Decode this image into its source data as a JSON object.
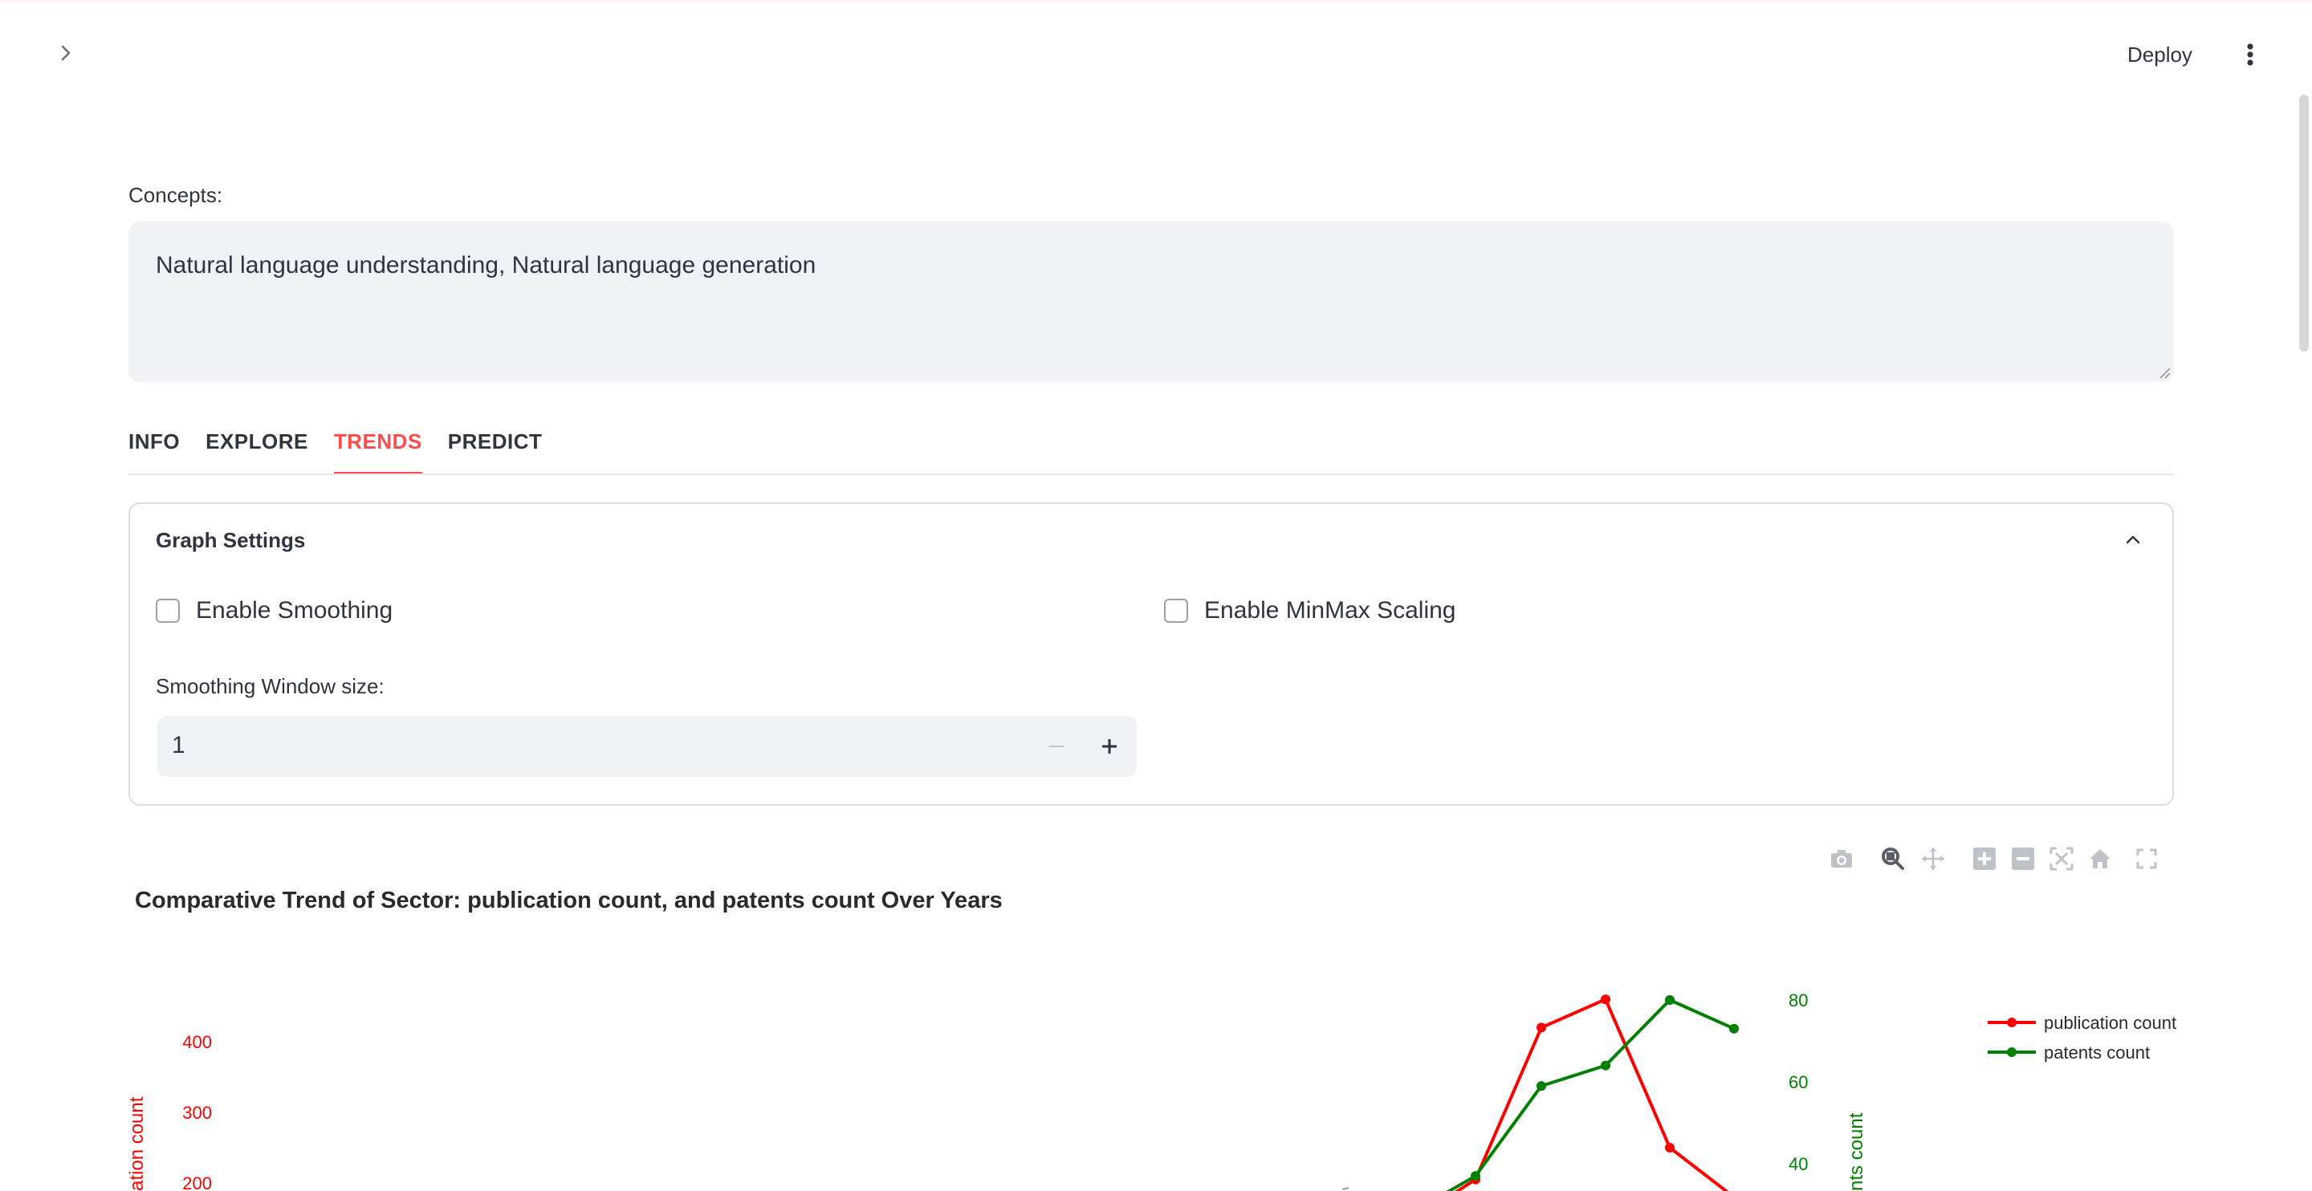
{
  "header": {
    "deploy_label": "Deploy"
  },
  "concepts": {
    "label": "Concepts:",
    "value": "Natural language understanding, Natural language generation"
  },
  "tabs": [
    {
      "label": "INFO",
      "active": false
    },
    {
      "label": "EXPLORE",
      "active": false
    },
    {
      "label": "TRENDS",
      "active": true
    },
    {
      "label": "PREDICT",
      "active": false
    }
  ],
  "graph_settings": {
    "title": "Graph Settings",
    "enable_smoothing": {
      "label": "Enable Smoothing",
      "checked": false
    },
    "enable_minmax": {
      "label": "Enable MinMax Scaling",
      "checked": false
    },
    "window_label": "Smoothing Window size:",
    "window_value": "1"
  },
  "modebar_icons": [
    "camera-icon",
    "zoom-icon",
    "pan-icon",
    "zoom-in-icon",
    "zoom-out-icon",
    "autoscale-icon",
    "reset-axes-icon",
    "fullscreen-icon"
  ],
  "colors": {
    "accent": "#ff4b4b",
    "publication": "#ff0000",
    "patents": "#008000"
  },
  "chart_data": {
    "type": "line",
    "title": "Comparative Trend of  Sector: publication count, and patents count Over Years",
    "ylabel_left_visible": "ation count",
    "ylabel_right_visible": "nts count",
    "yticks_left": [
      200,
      300,
      400
    ],
    "yticks_right": [
      40,
      60,
      80
    ],
    "series": [
      {
        "name": "publication count",
        "axis": "left",
        "color": "#ff0000",
        "values": [
          205,
          420,
          460,
          250,
          180
        ]
      },
      {
        "name": "patents count",
        "axis": "right",
        "color": "#008000",
        "values": [
          37,
          59,
          64,
          80,
          73
        ]
      }
    ],
    "legend": [
      "publication count",
      "patents count"
    ],
    "legend_position": "right"
  }
}
